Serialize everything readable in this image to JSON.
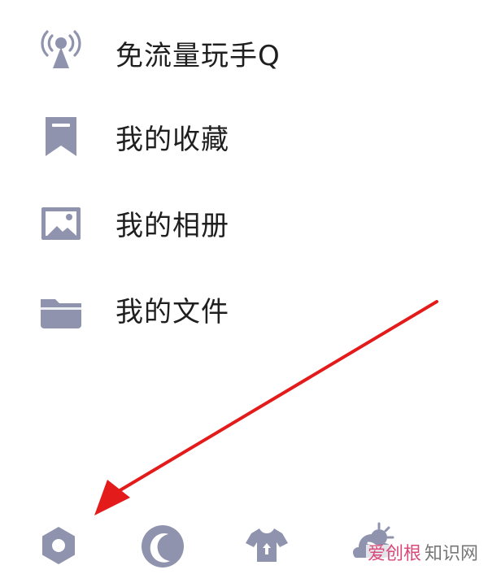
{
  "menu": {
    "items": [
      {
        "label": "免流量玩手Q",
        "icon": "signal-tower-icon"
      },
      {
        "label": "我的收藏",
        "icon": "bookmark-icon"
      },
      {
        "label": "我的相册",
        "icon": "image-icon"
      },
      {
        "label": "我的文件",
        "icon": "folder-icon"
      }
    ]
  },
  "bottom_bar": {
    "icons": [
      "settings-icon",
      "night-mode-icon",
      "dress-up-icon",
      "weather-icon"
    ]
  },
  "watermark": {
    "left": "爱创根",
    "right": "知识网"
  },
  "colors": {
    "icon": "#8f93ad",
    "text": "#1f1f1f",
    "arrow": "#e31b1b"
  }
}
